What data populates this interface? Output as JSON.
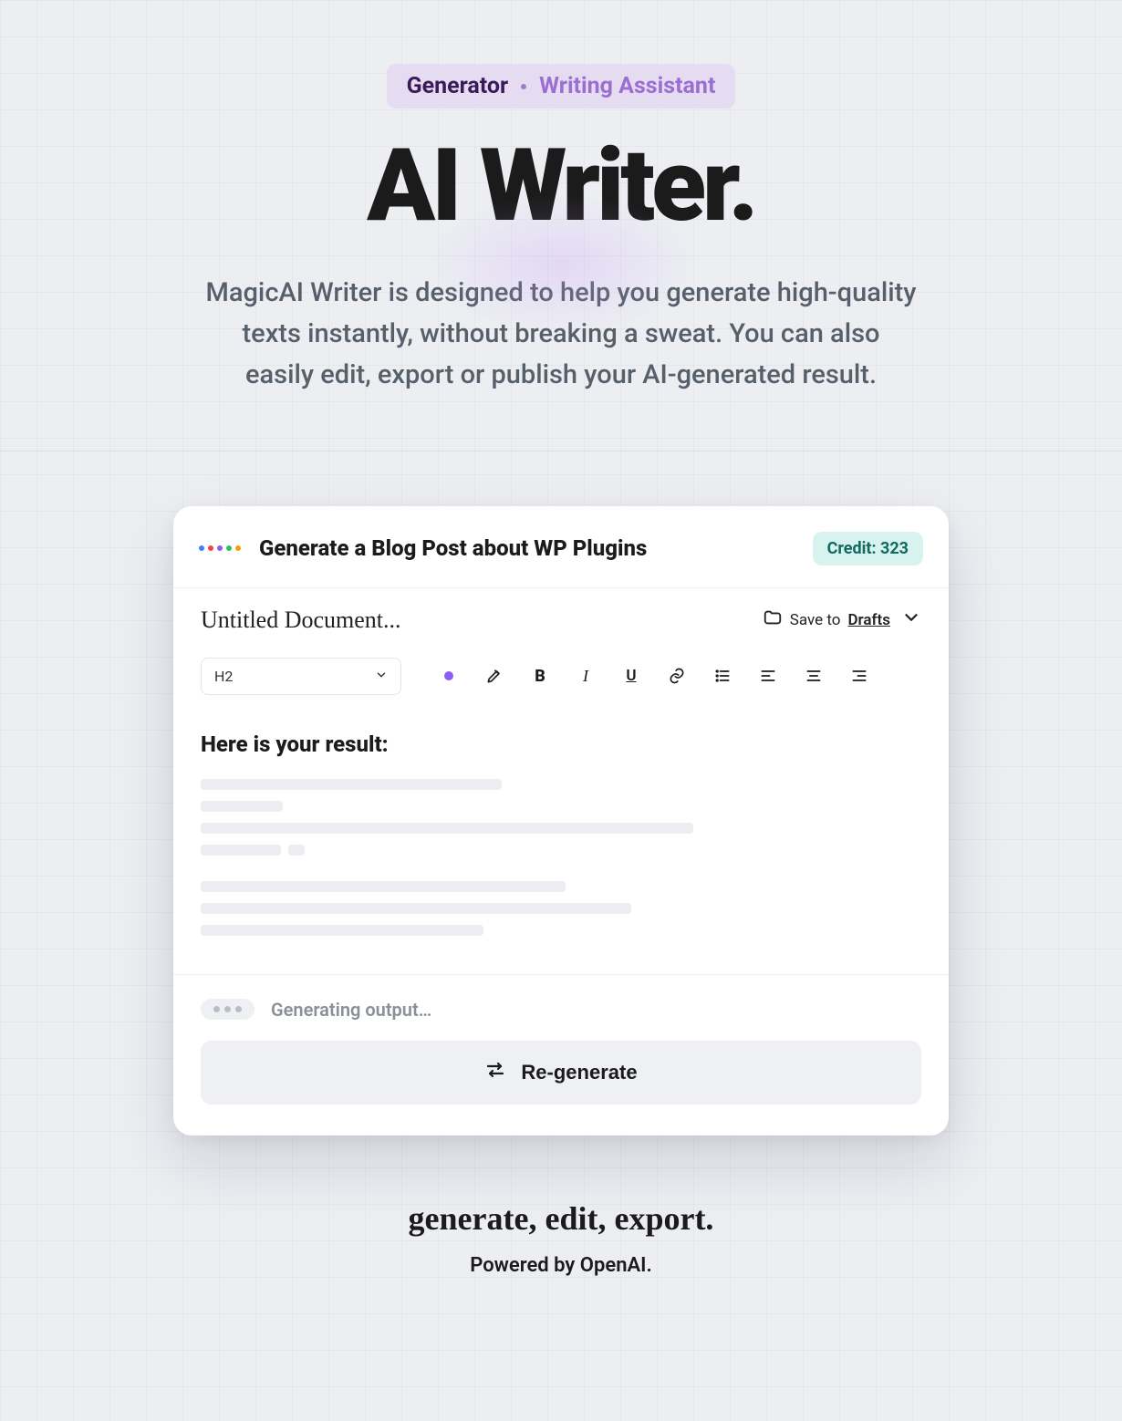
{
  "header": {
    "tab_primary": "Generator",
    "tab_secondary": "Writing Assistant",
    "title": "AI Writer.",
    "subtitle": "MagicAI Writer is designed to help you generate high-quality texts instantly, without breaking a sweat. You can also easily edit, export or publish your AI-generated result."
  },
  "card": {
    "prompt_title": "Generate a Blog Post about WP Plugins",
    "credit_label": "Credit: 323",
    "doc_title": "Untitled Document...",
    "save_prefix": "Save to",
    "save_target": "Drafts",
    "heading_select": "H2",
    "result_heading": "Here is your result:",
    "generating_label": "Generating output…",
    "regenerate_label": "Re-generate"
  },
  "footer": {
    "cursive": "generate, edit, export.",
    "powered": "Powered by OpenAI."
  },
  "colors": {
    "accent_purple": "#8b5cf6",
    "pill_bg": "#e6dcf2",
    "credit_bg": "#d8f3ef",
    "credit_fg": "#0f6a5f"
  }
}
